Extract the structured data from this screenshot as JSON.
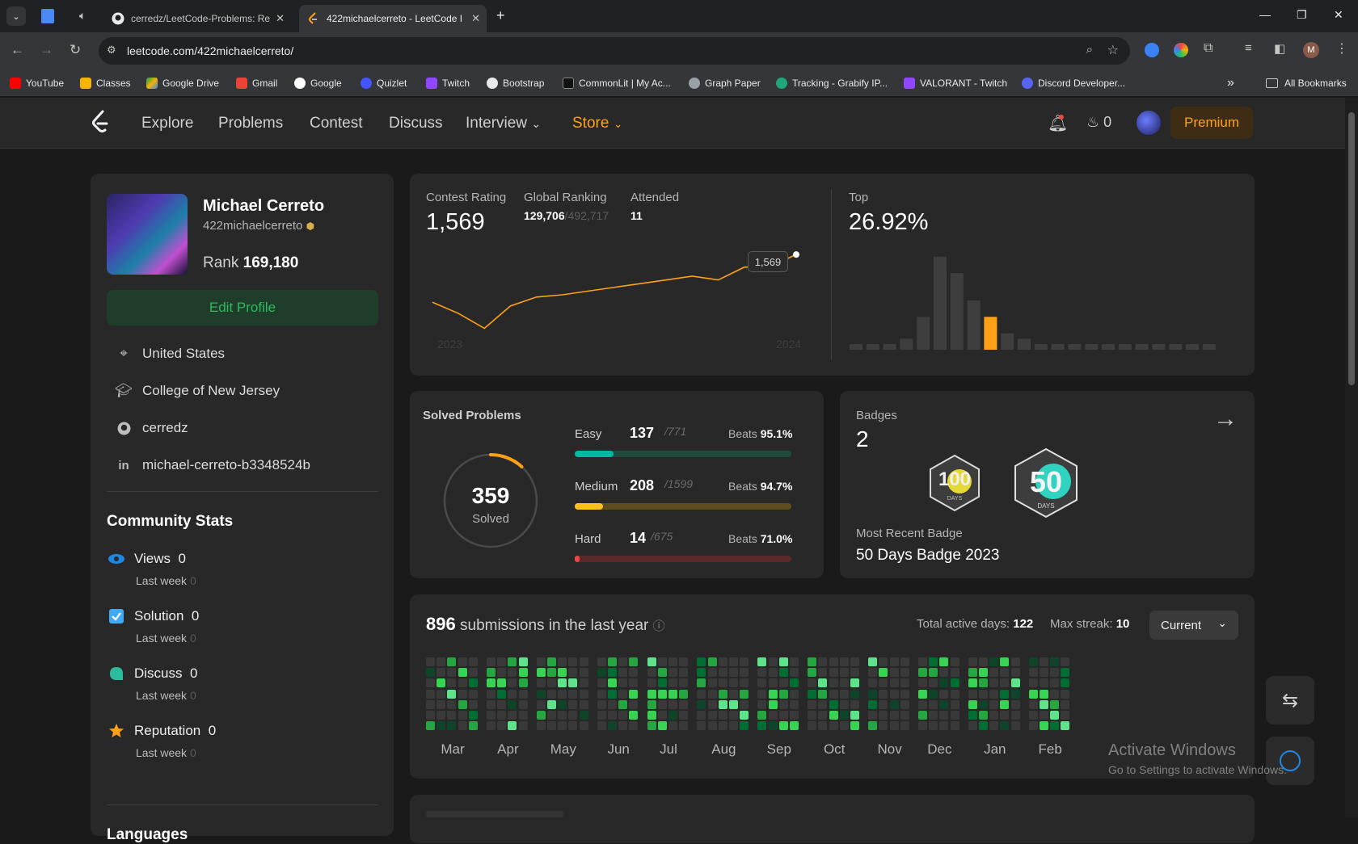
{
  "browser": {
    "tabs": [
      {
        "title": "cerredz/LeetCode-Problems: Re"
      },
      {
        "title": "422michaelcerreto - LeetCode I"
      }
    ],
    "url": "leetcode.com/422michaelcerreto/",
    "profile_initial": "M",
    "bookmarks": [
      "YouTube",
      "Classes",
      "Google Drive",
      "Gmail",
      "Google",
      "Quizlet",
      "Twitch",
      "Bootstrap",
      "CommonLit | My Ac...",
      "Graph Paper",
      "Tracking - Grabify IP...",
      "VALORANT - Twitch",
      "Discord Developer..."
    ],
    "all_bookmarks": "All Bookmarks",
    "overflow": "»"
  },
  "nav": {
    "items": [
      "Explore",
      "Problems",
      "Contest",
      "Discuss",
      "Interview",
      "Store"
    ],
    "streak": "0",
    "premium": "Premium"
  },
  "profile": {
    "name": "Michael Cerreto",
    "username": "422michaelcerreto",
    "rank_label": "Rank",
    "rank": "169,180",
    "edit": "Edit Profile",
    "location": "United States",
    "school": "College of New Jersey",
    "github": "cerredz",
    "linkedin": "michael-cerreto-b3348524b"
  },
  "community": {
    "title": "Community Stats",
    "items": [
      {
        "name": "Views",
        "value": "0",
        "sub": "Last week",
        "sub_value": "0"
      },
      {
        "name": "Solution",
        "value": "0",
        "sub": "Last week",
        "sub_value": "0"
      },
      {
        "name": "Discuss",
        "value": "0",
        "sub": "Last week",
        "sub_value": "0"
      },
      {
        "name": "Reputation",
        "value": "0",
        "sub": "Last week",
        "sub_value": "0"
      }
    ],
    "languages": "Languages"
  },
  "contest": {
    "rating_label": "Contest Rating",
    "rating": "1,569",
    "global_label": "Global Ranking",
    "global_rank": "129,706",
    "global_total": "/492,717",
    "attended_label": "Attended",
    "attended": "11",
    "top_label": "Top",
    "top_value": "26.92%",
    "tooltip": "1,569",
    "year_start": "2023",
    "year_end": "2024"
  },
  "solved": {
    "title": "Solved Problems",
    "total": "359",
    "total_label": "Solved",
    "beats_label": "Beats",
    "rows": [
      {
        "name": "Easy",
        "count": "137",
        "total": "/771",
        "beats": "95.1%",
        "color": "#00b8a3",
        "fraction": 0.178
      },
      {
        "name": "Medium",
        "count": "208",
        "total": "/1599",
        "beats": "94.7%",
        "color": "#ffc01e",
        "fraction": 0.13
      },
      {
        "name": "Hard",
        "count": "14",
        "total": "/675",
        "beats": "71.0%",
        "color": "#ef4743",
        "fraction": 0.021
      }
    ]
  },
  "badges": {
    "title": "Badges",
    "count": "2",
    "recent_label": "Most Recent Badge",
    "recent": "50 Days Badge 2023",
    "badge1_text": "100",
    "badge1_sub": "DAYS",
    "badge2_text": "50",
    "badge2_sub": "DAYS"
  },
  "submissions": {
    "count": "896",
    "label": "submissions in the last year",
    "active_label": "Total active days:",
    "active": "122",
    "streak_label": "Max streak:",
    "streak": "10",
    "dropdown": "Current",
    "months": [
      "Mar",
      "Apr",
      "May",
      "Jun",
      "Jul",
      "Aug",
      "Sep",
      "Oct",
      "Nov",
      "Dec",
      "Jan",
      "Feb"
    ]
  },
  "watermark": {
    "line1": "Activate Windows",
    "line2": "Go to Settings to activate Windows."
  },
  "chart_data": [
    {
      "type": "line",
      "title": "Contest Rating",
      "x_range": [
        "2023",
        "2024"
      ],
      "values": [
        1505,
        1490,
        1470,
        1500,
        1512,
        1515,
        1520,
        1525,
        1530,
        1535,
        1540,
        1535,
        1552,
        1553,
        1569
      ],
      "ylim": [
        1450,
        1580
      ]
    },
    {
      "type": "bar",
      "title": "Top",
      "values": [
        1,
        1,
        1,
        2,
        6,
        17,
        14,
        9,
        6,
        3,
        2,
        1,
        1,
        1,
        1,
        1,
        1,
        1,
        1,
        1,
        1,
        1
      ],
      "highlight_index": 8,
      "ylim": [
        0,
        18
      ]
    }
  ]
}
